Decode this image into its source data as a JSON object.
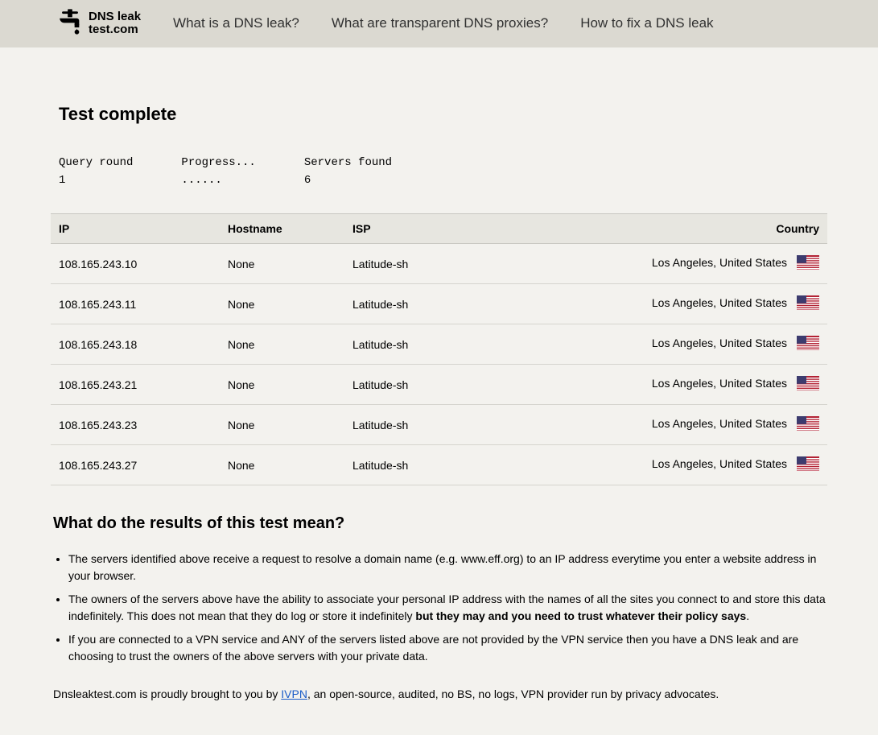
{
  "header": {
    "logo_line1": "DNS leak",
    "logo_line2": "test.com",
    "nav": [
      "What is a DNS leak?",
      "What are transparent DNS proxies?",
      "How to fix a DNS leak"
    ]
  },
  "main": {
    "title": "Test complete",
    "status": {
      "round_label": "Query round",
      "round_value": "1",
      "progress_label": "Progress...",
      "progress_value": "......",
      "servers_label": "Servers found",
      "servers_value": "6"
    },
    "columns": {
      "ip": "IP",
      "hostname": "Hostname",
      "isp": "ISP",
      "country": "Country"
    },
    "rows": [
      {
        "ip": "108.165.243.10",
        "hostname": "None",
        "isp": "Latitude-sh",
        "country": "Los Angeles, United States",
        "flag": "us"
      },
      {
        "ip": "108.165.243.11",
        "hostname": "None",
        "isp": "Latitude-sh",
        "country": "Los Angeles, United States",
        "flag": "us"
      },
      {
        "ip": "108.165.243.18",
        "hostname": "None",
        "isp": "Latitude-sh",
        "country": "Los Angeles, United States",
        "flag": "us"
      },
      {
        "ip": "108.165.243.21",
        "hostname": "None",
        "isp": "Latitude-sh",
        "country": "Los Angeles, United States",
        "flag": "us"
      },
      {
        "ip": "108.165.243.23",
        "hostname": "None",
        "isp": "Latitude-sh",
        "country": "Los Angeles, United States",
        "flag": "us"
      },
      {
        "ip": "108.165.243.27",
        "hostname": "None",
        "isp": "Latitude-sh",
        "country": "Los Angeles, United States",
        "flag": "us"
      }
    ],
    "subheading": "What do the results of this test mean?",
    "bullets": {
      "b1": "The servers identified above receive a request to resolve a domain name (e.g. www.eff.org) to an IP address everytime you enter a website address in your browser.",
      "b2a": "The owners of the servers above have the ability to associate your personal IP address with the names of all the sites you connect to and store this data indefinitely. This does not mean that they do log or store it indefinitely ",
      "b2b": "but they may and you need to trust whatever their policy says",
      "b2c": ".",
      "b3": "If you are connected to a VPN service and ANY of the servers listed above are not provided by the VPN service then you have a DNS leak and are choosing to trust the owners of the above servers with your private data."
    },
    "footer": {
      "pre": "Dnsleaktest.com is proudly brought to you by ",
      "link": "IVPN",
      "post": ", an open-source, audited, no BS, no logs, VPN provider run by privacy advocates."
    }
  }
}
